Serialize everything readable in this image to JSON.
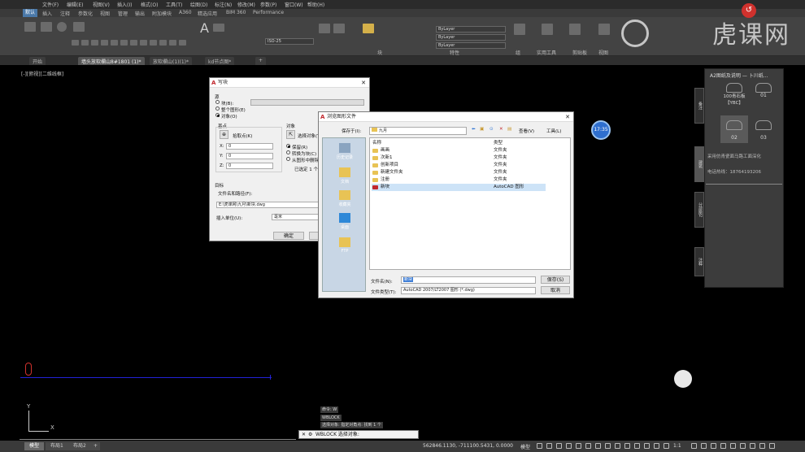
{
  "app": {
    "menu": [
      "文件(F)",
      "编辑(E)",
      "视图(V)",
      "插入(I)",
      "格式(O)",
      "工具(T)",
      "绘图(D)",
      "标注(N)",
      "修改(M)",
      "参数(P)",
      "窗口(W)",
      "帮助(H)"
    ],
    "ribbon_tabs": [
      "默认",
      "插入",
      "注释",
      "参数化",
      "视图",
      "管理",
      "输出",
      "附加模块",
      "A360",
      "精选应用",
      "BIM 360",
      "Performance"
    ],
    "active_ribbon_tab_index": 0,
    "panels": [
      "块",
      "特性",
      "组",
      "实用工具",
      "剪贴板",
      "视图"
    ],
    "layer_combo": "ISO-25",
    "bylayer": [
      "ByLayer",
      "ByLayer",
      "ByLayer"
    ]
  },
  "watermark": {
    "text": "虎课网"
  },
  "doc_tabs": [
    "开始",
    "墙头放软欄山8#1801 (1)*",
    "放软欄山(1)(1)*",
    "kd节点图*"
  ],
  "active_doc_tab_index": 1,
  "view_label": "[-][俯视][二维线框]",
  "palette": {
    "title": "A2图纸及说明 — 卜川纸...",
    "items": [
      {
        "label": "100青石板\n【YBC】"
      },
      {
        "label": "01"
      },
      {
        "label": "02"
      },
      {
        "label": "03"
      }
    ],
    "selected_index": 2,
    "note": "采用仿青瓷面马路工面深化",
    "phone": "电话热线：18764193206",
    "side_tabs": [
      "备注",
      "建筑",
      "分部图2",
      "注释"
    ]
  },
  "write_block": {
    "title": "写块",
    "source_label": "源",
    "source_options": [
      "块(B):",
      "整个图形(E)",
      "对象(O)"
    ],
    "source_selected": 2,
    "base_point_label": "基点",
    "pick_point_label": "拾取点(K)",
    "x": "0",
    "y": "0",
    "z": "0",
    "x_label": "X:",
    "y_label": "Y:",
    "z_label": "Z:",
    "objects_label": "对象",
    "select_objects_label": "选择对象(T)",
    "object_options": [
      "保留(R)",
      "转换为块(C)",
      "从图形中删除(D)"
    ],
    "object_selected": 0,
    "selected_count": "已选定 1 个对象",
    "target_label": "目标",
    "path_label": "文件名和路径(F):",
    "path_value": "E:\\虎课网\\九月\\新块.dwg",
    "units_label": "插入单位(U):",
    "units_value": "毫米",
    "ok_label": "确定",
    "cancel_label": "取消"
  },
  "browse": {
    "title": "浏览图形文件",
    "save_in_label": "保存于(I):",
    "folder": "九月",
    "view_label": "查看(V)",
    "tools_label": "工具(L)",
    "places": [
      "历史记录",
      "文档",
      "收藏夹",
      "桌面",
      "FTP"
    ],
    "col_name": "名称",
    "col_type": "类型",
    "files": [
      {
        "name": "画画",
        "type": "文件夹",
        "kind": "folder"
      },
      {
        "name": "次新1",
        "type": "文件夹",
        "kind": "folder"
      },
      {
        "name": "创新项目",
        "type": "文件夹",
        "kind": "folder"
      },
      {
        "name": "新建文件夹",
        "type": "文件夹",
        "kind": "folder"
      },
      {
        "name": "注册",
        "type": "文件夹",
        "kind": "folder"
      },
      {
        "name": "新块",
        "type": "AutoCAD 图形",
        "kind": "dwg"
      }
    ],
    "selected_index": 5,
    "filename_label": "文件名(N):",
    "filename_value": "新块",
    "filetype_label": "文件类型(T):",
    "filetype_value": "AutoCAD 2007/LT2007 图形 (*.dwg)",
    "save_label": "保存(S)",
    "cancel_label": "取消"
  },
  "time_badge": "17:35",
  "command": {
    "history": [
      "命令: W",
      "WBLOCK",
      "选择对象: 指定对角点: 找到 1 个"
    ],
    "prompt": "WBLOCK 选择对象:"
  },
  "layout_tabs": [
    "模型",
    "布局1",
    "布局2"
  ],
  "active_layout_index": 0,
  "status": {
    "coords": "562846.1130, -711100.5431, 0.0000",
    "mode": "模型",
    "scale": "1:1"
  },
  "colors": {
    "accent": "#4a78a8",
    "red": "#d0312d",
    "drawing_blue": "#2222d8"
  }
}
